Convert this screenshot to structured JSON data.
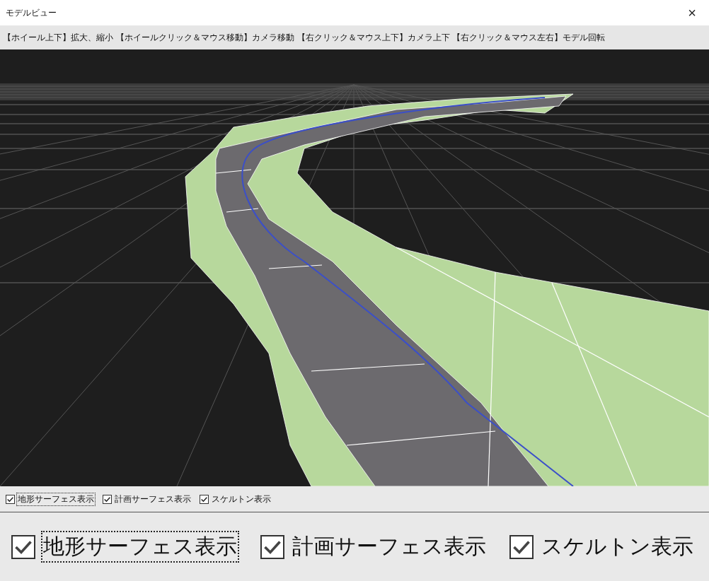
{
  "window": {
    "title": "モデルビュー",
    "close": "×"
  },
  "hint_bar": "【ホイール上下】拡大、縮小 【ホイールクリック＆マウス移動】カメラ移動 【右クリック＆マウス上下】カメラ上下 【右クリック＆マウス左右】モデル回転",
  "view_options": [
    {
      "label": "地形サーフェス表示",
      "checked": true,
      "focused": true
    },
    {
      "label": "計画サーフェス表示",
      "checked": true,
      "focused": false
    },
    {
      "label": "スケルトン表示",
      "checked": true,
      "focused": false
    }
  ],
  "view_options_zoomed": [
    {
      "label": "地形サーフェス表示",
      "checked": true,
      "focused": true
    },
    {
      "label": "計画サーフェス表示",
      "checked": true,
      "focused": false
    },
    {
      "label": "スケルトン表示",
      "checked": true,
      "focused": false
    }
  ]
}
